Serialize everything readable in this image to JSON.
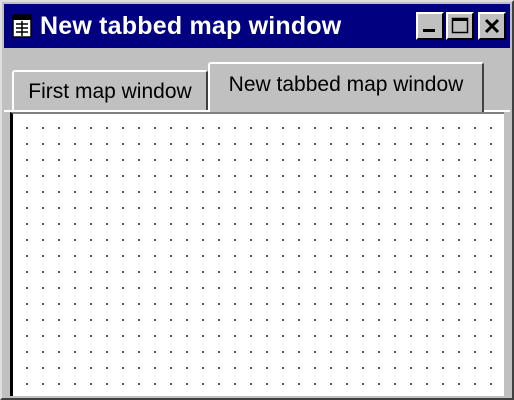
{
  "window": {
    "title": "New tabbed map window",
    "app_icon": "map-document-icon",
    "controls": {
      "minimize_icon": "minimize-icon",
      "maximize_icon": "maximize-icon",
      "close_icon": "close-icon"
    }
  },
  "tabs": [
    {
      "label": "First map window",
      "active": false
    },
    {
      "label": "New tabbed map window",
      "active": true
    }
  ],
  "colors": {
    "titlebar": "#000080",
    "face": "#c0c0c0",
    "canvas": "#ffffff",
    "grid_dots": "#000000"
  }
}
